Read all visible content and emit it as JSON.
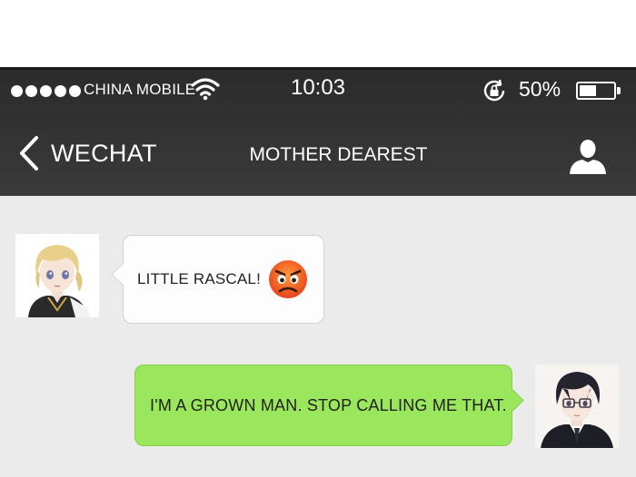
{
  "status_bar": {
    "carrier": "CHINA MOBILE",
    "time": "10:03",
    "battery_percent": "50%",
    "battery_level": 0.5,
    "signal_icon": "signal-dots-icon",
    "wifi_icon": "wifi-icon",
    "rotation_lock_icon": "rotation-lock-icon"
  },
  "nav": {
    "back_label": "WECHAT",
    "back_icon": "chevron-left-icon",
    "title": "MOTHER DEAREST",
    "profile_icon": "person-icon"
  },
  "messages": [
    {
      "from": "contact",
      "text": "LITTLE RASCAL!",
      "emoji": "angry-face-icon"
    },
    {
      "from": "me",
      "text": "I'M A GROWN MAN. STOP CALLING ME THAT."
    }
  ],
  "colors": {
    "bar_background": "#333333",
    "chat_background": "#ebebeb",
    "outgoing_bubble": "#9ae65c",
    "incoming_bubble": "#fdfdfd"
  }
}
